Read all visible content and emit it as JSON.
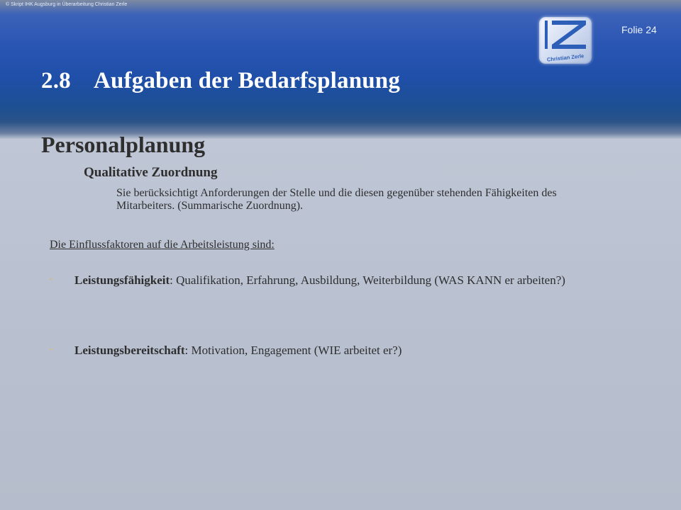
{
  "header": {
    "copyright": "© Skript IHK Augsburg in Überarbeitung Christian Zerle",
    "slide_number": "Folie 24",
    "logo_text": "Christian Zerle"
  },
  "title": {
    "number": "2.8",
    "text": "Aufgaben der Bedarfsplanung"
  },
  "subtitle": "Personalplanung",
  "section": {
    "heading": "Qualitative Zuordnung",
    "text": "Sie berücksichtigt Anforderungen der Stelle und die diesen gegenüber stehenden Fähigkeiten des Mitarbeiters. (Summarische Zuordnung)."
  },
  "factors": {
    "heading": "Die Einflussfaktoren auf die Arbeitsleistung sind:",
    "items": [
      {
        "marker": "•",
        "term": "Leistungsfähigkeit",
        "rest": ": Qualifikation, Erfahrung, Ausbildung, Weiterbildung (WAS KANN er arbeiten?)"
      },
      {
        "marker": "•",
        "term": "Leistungsbereitschaft",
        "rest": ": Motivation, Engagement (WIE arbeitet er?)"
      }
    ]
  },
  "colors": {
    "header_blue": "#2b56b4",
    "background": "#bcc4d4",
    "text": "#2e2e2e",
    "bullet": "#d9b86a"
  }
}
